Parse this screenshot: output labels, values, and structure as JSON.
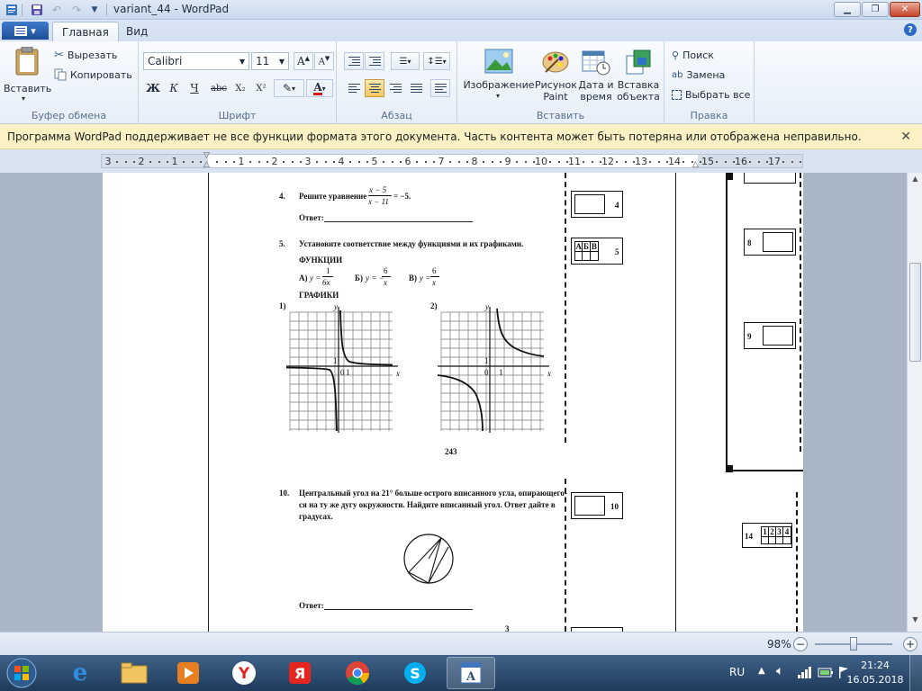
{
  "window": {
    "title": "variant_44 - WordPad"
  },
  "tabs": {
    "app_menu_arrow": "▾",
    "home": "Главная",
    "view": "Вид"
  },
  "clipboard": {
    "paste": "Вставить",
    "cut": "Вырезать",
    "copy": "Копировать",
    "group": "Буфер обмена"
  },
  "font": {
    "family": "Calibri",
    "size": "11",
    "group": "Шрифт",
    "bold": "Ж",
    "italic": "К",
    "underline": "Ч",
    "strike": "abc",
    "sub": "X₂",
    "sup": "X²"
  },
  "paragraph": {
    "group": "Абзац"
  },
  "insert": {
    "image": "Изображение",
    "paint_line1": "Рисунок",
    "paint_line2": "Paint",
    "datetime_line1": "Дата и",
    "datetime_line2": "время",
    "object_line1": "Вставка",
    "object_line2": "объекта",
    "group": "Вставить"
  },
  "editing": {
    "find": "Поиск",
    "replace": "Замена",
    "select_all": "Выбрать все",
    "group": "Правка"
  },
  "infobar": {
    "message": "Программа WordPad поддерживает не все функции формата этого документа. Часть контента может быть потеряна или отображена неправильно."
  },
  "ruler": {
    "labels": [
      "3",
      "2",
      "1",
      "1",
      "2",
      "3",
      "4",
      "5",
      "6",
      "7",
      "8",
      "9",
      "10",
      "11",
      "12",
      "13",
      "14",
      "15",
      "16",
      "17"
    ]
  },
  "document": {
    "q4_num": "4.",
    "q4_text": "Решите уравнение",
    "q4_num_top": "x − 5",
    "q4_num_bottom": "x − 11",
    "q4_rhs": "= −5.",
    "answer_label": "Ответ:",
    "q5_num": "5.",
    "q5_text": "Установите соответствие между функциями и их графиками.",
    "functions_label": "ФУНКЦИИ",
    "fa_label": "А)",
    "fa_y": "y =",
    "fa_top": "1",
    "fa_bottom": "6x",
    "fb_label": "Б)",
    "fb_y": "y = −",
    "fb_top": "6",
    "fb_bottom": "x",
    "fc_label": "В)",
    "fc_y": "y =",
    "fc_top": "6",
    "fc_bottom": "x",
    "graphs_label": "ГРАФИКИ",
    "g1_label": "1)",
    "g2_label": "2)",
    "axis_y": "y",
    "axis_x": "x",
    "axis_zero": "0",
    "axis_one": "1",
    "page_num": "243",
    "box4": "4",
    "box5": "5",
    "box5_cells": [
      "А",
      "Б",
      "В"
    ],
    "box8": "8",
    "box9": "9",
    "box10": "10",
    "box14": "14",
    "box14_cells": [
      "1",
      "2",
      "3",
      "4"
    ],
    "q10_num": "10.",
    "q10_line1": "Центральный угол на 21° больше острого вписанного угла, опирающего-",
    "q10_line2": "ся на ту же дугу окружности. Найдите вписанный угол. Ответ дайте в",
    "q10_line3": "градусах.",
    "bottom_num": "3"
  },
  "status": {
    "zoom": "98%",
    "zoom_out": "−",
    "zoom_in": "+"
  },
  "taskbar": {
    "lang": "RU",
    "time": "21:24",
    "date": "16.05.2018"
  }
}
